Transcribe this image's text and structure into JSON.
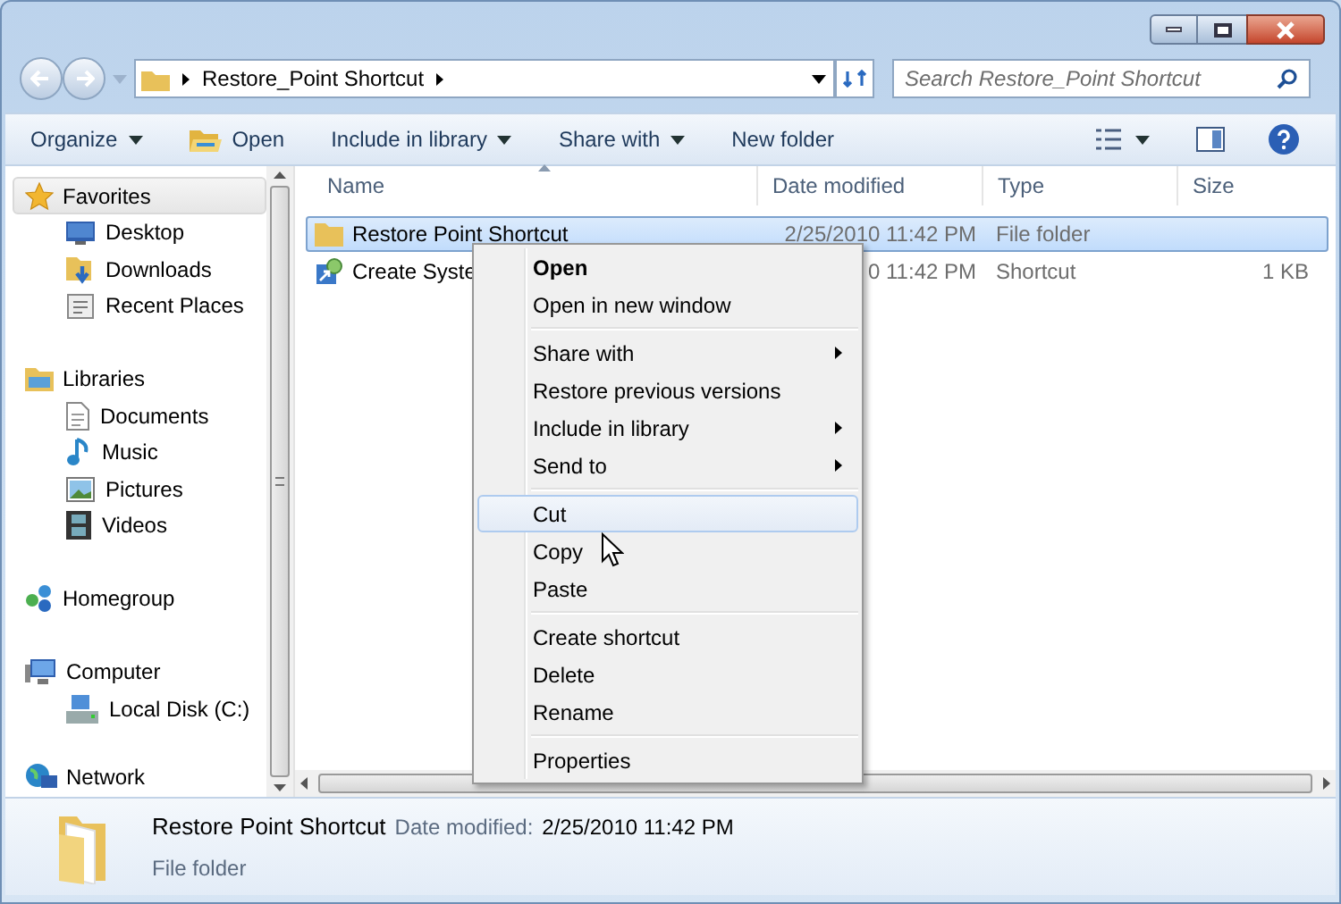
{
  "address": {
    "path": "Restore_Point Shortcut"
  },
  "search": {
    "placeholder": "Search Restore_Point Shortcut"
  },
  "toolbar": [
    {
      "label": "Organize",
      "dropdown": true
    },
    {
      "label": "Open",
      "dropdown": false
    },
    {
      "label": "Include in library",
      "dropdown": true
    },
    {
      "label": "Share with",
      "dropdown": true
    },
    {
      "label": "New folder",
      "dropdown": false
    }
  ],
  "nav": [
    {
      "label": "Favorites",
      "selected": true,
      "children": [
        {
          "label": "Desktop",
          "selected": false
        },
        {
          "label": "Downloads",
          "selected": false
        },
        {
          "label": "Recent Places",
          "selected": false
        }
      ]
    },
    {
      "label": "Libraries",
      "selected": false,
      "children": [
        {
          "label": "Documents",
          "selected": false
        },
        {
          "label": "Music",
          "selected": false
        },
        {
          "label": "Pictures",
          "selected": false
        },
        {
          "label": "Videos",
          "selected": false
        }
      ]
    },
    {
      "label": "Homegroup",
      "selected": false
    },
    {
      "label": "Computer",
      "selected": false,
      "children": [
        {
          "label": "Local Disk (C:)",
          "selected": false
        }
      ]
    },
    {
      "label": "Network",
      "selected": false
    }
  ],
  "columns": [
    "Name",
    "Date modified",
    "Type",
    "Size"
  ],
  "rows": [
    {
      "name": "Restore Point Shortcut",
      "date": "2/25/2010 11:42 PM",
      "type": "File folder",
      "selected": true
    },
    {
      "name": "Create Syste",
      "date": "0 11:42 PM",
      "type": "Shortcut",
      "size": "1 KB",
      "selected": false
    }
  ],
  "context_menu": [
    [
      {
        "label": "Open",
        "bold": true,
        "submenu": false,
        "selected": false
      },
      {
        "label": "Open in new window",
        "bold": false,
        "submenu": false,
        "selected": false
      }
    ],
    [
      {
        "label": "Share with",
        "bold": false,
        "submenu": true,
        "selected": false
      },
      {
        "label": "Restore previous versions",
        "bold": false,
        "submenu": false,
        "selected": false
      },
      {
        "label": "Include in library",
        "bold": false,
        "submenu": true,
        "selected": false
      },
      {
        "label": "Send to",
        "bold": false,
        "submenu": true,
        "selected": false
      }
    ],
    [
      {
        "label": "Cut",
        "bold": false,
        "submenu": false,
        "selected": true
      },
      {
        "label": "Copy",
        "bold": false,
        "submenu": false,
        "selected": false
      },
      {
        "label": "Paste",
        "bold": false,
        "submenu": false,
        "selected": false
      }
    ],
    [
      {
        "label": "Create shortcut",
        "bold": false,
        "submenu": false,
        "selected": false
      },
      {
        "label": "Delete",
        "bold": false,
        "submenu": false,
        "selected": false
      },
      {
        "label": "Rename",
        "bold": false,
        "submenu": false,
        "selected": false
      }
    ],
    [
      {
        "label": "Properties",
        "bold": false,
        "submenu": false,
        "selected": false
      }
    ]
  ],
  "details": {
    "name": "Restore Point Shortcut",
    "date_label": "Date modified:",
    "date": "2/25/2010 11:42 PM",
    "type": "File folder"
  }
}
